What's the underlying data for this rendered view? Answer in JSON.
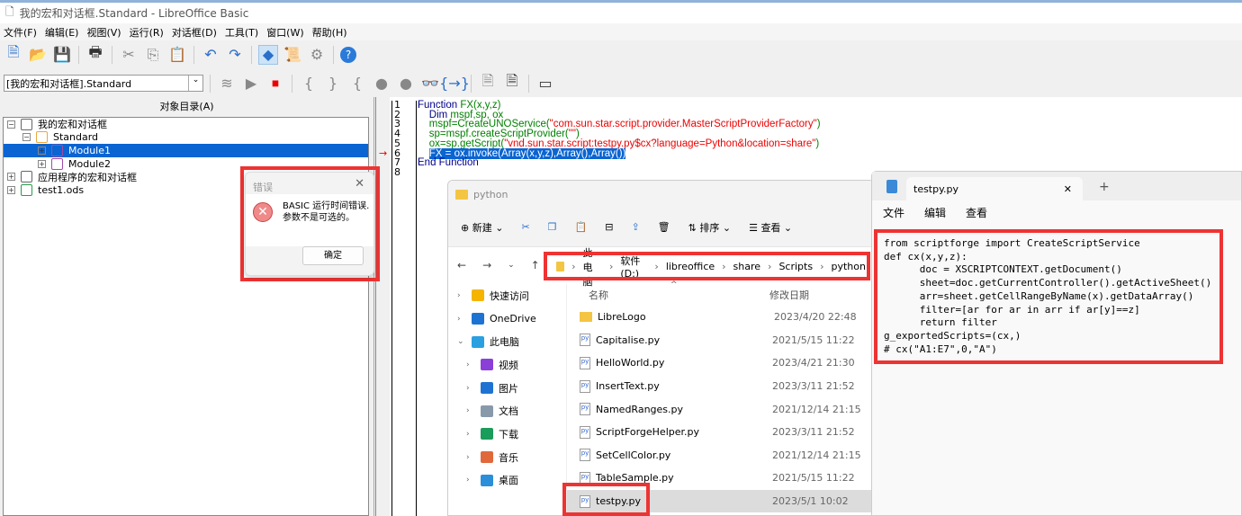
{
  "window": {
    "title": "我的宏和对话框.Standard - LibreOffice Basic"
  },
  "menu": [
    "文件(F)",
    "编辑(E)",
    "视图(V)",
    "运行(R)",
    "对话框(D)",
    "工具(T)",
    "窗口(W)",
    "帮助(H)"
  ],
  "library_selector": {
    "value": "[我的宏和对话框].Standard"
  },
  "object_catalog": {
    "title": "对象目录(A)",
    "items": [
      {
        "label": "我的宏和对话框",
        "level": 0,
        "expanded": true
      },
      {
        "label": "Standard",
        "level": 1,
        "expanded": true
      },
      {
        "label": "Module1",
        "level": 2,
        "selected": true
      },
      {
        "label": "Module2",
        "level": 2
      },
      {
        "label": "应用程序的宏和对话框",
        "level": 0
      },
      {
        "label": "test1.ods",
        "level": 0
      }
    ]
  },
  "editor": {
    "line_numbers": [
      "1",
      "2",
      "3",
      "4",
      "5",
      "6",
      "7",
      "8"
    ],
    "current_line": 6
  },
  "error_dialog": {
    "title": "错误",
    "message_line1": "BASIC 运行时间错误.",
    "message_line2": "参数不是可选的。",
    "ok": "确定"
  },
  "explorer": {
    "title": "python",
    "toolbar": {
      "new": "新建",
      "sort": "排序",
      "view": "查看"
    },
    "breadcrumb": [
      "此电脑",
      "软件 (D:)",
      "libreoffice",
      "share",
      "Scripts",
      "python"
    ],
    "nav": [
      {
        "label": "快速访问",
        "color": "#f4b400"
      },
      {
        "label": "OneDrive",
        "color": "#1e73d2"
      },
      {
        "label": "此电脑",
        "color": "#2aa0e0"
      },
      {
        "label": "视频",
        "color": "#8b3fd9"
      },
      {
        "label": "图片",
        "color": "#1e73d2"
      },
      {
        "label": "文档",
        "color": "#8899aa"
      },
      {
        "label": "下载",
        "color": "#1a9c5a"
      },
      {
        "label": "音乐",
        "color": "#e0683a"
      },
      {
        "label": "桌面",
        "color": "#2a8fd8"
      }
    ],
    "columns": {
      "name": "名称",
      "date": "修改日期"
    },
    "files": [
      {
        "name": "LibreLogo",
        "date": "2023/4/20 22:48",
        "folder": true
      },
      {
        "name": "Capitalise.py",
        "date": "2021/5/15 11:22"
      },
      {
        "name": "HelloWorld.py",
        "date": "2023/4/21 21:30"
      },
      {
        "name": "InsertText.py",
        "date": "2023/3/11 21:52"
      },
      {
        "name": "NamedRanges.py",
        "date": "2021/12/14 21:15"
      },
      {
        "name": "ScriptForgeHelper.py",
        "date": "2023/3/11 21:52"
      },
      {
        "name": "SetCellColor.py",
        "date": "2021/12/14 21:15"
      },
      {
        "name": "TableSample.py",
        "date": "2021/5/15 11:22"
      },
      {
        "name": "testpy.py",
        "date": "2023/5/1 10:02",
        "selected": true
      }
    ]
  },
  "notepad": {
    "tab": "testpy.py",
    "menu": [
      "文件",
      "编辑",
      "查看"
    ],
    "code": "from scriptforge import CreateScriptService\ndef cx(x,y,z):\n      doc = XSCRIPTCONTEXT.getDocument()\n      sheet=doc.getCurrentController().getActiveSheet()\n      arr=sheet.getCellRangeByName(x).getDataArray()\n      filter=[ar for ar in arr if ar[y]==z]\n      return filter\ng_exportedScripts=(cx,)\n# cx(\"A1:E7\",0,\"A\")"
  },
  "colors": {
    "highlight": "#0a64d2",
    "annotation": "#e33333",
    "keyword": "#00008b",
    "identifier": "#008000",
    "string": "#e00000"
  }
}
